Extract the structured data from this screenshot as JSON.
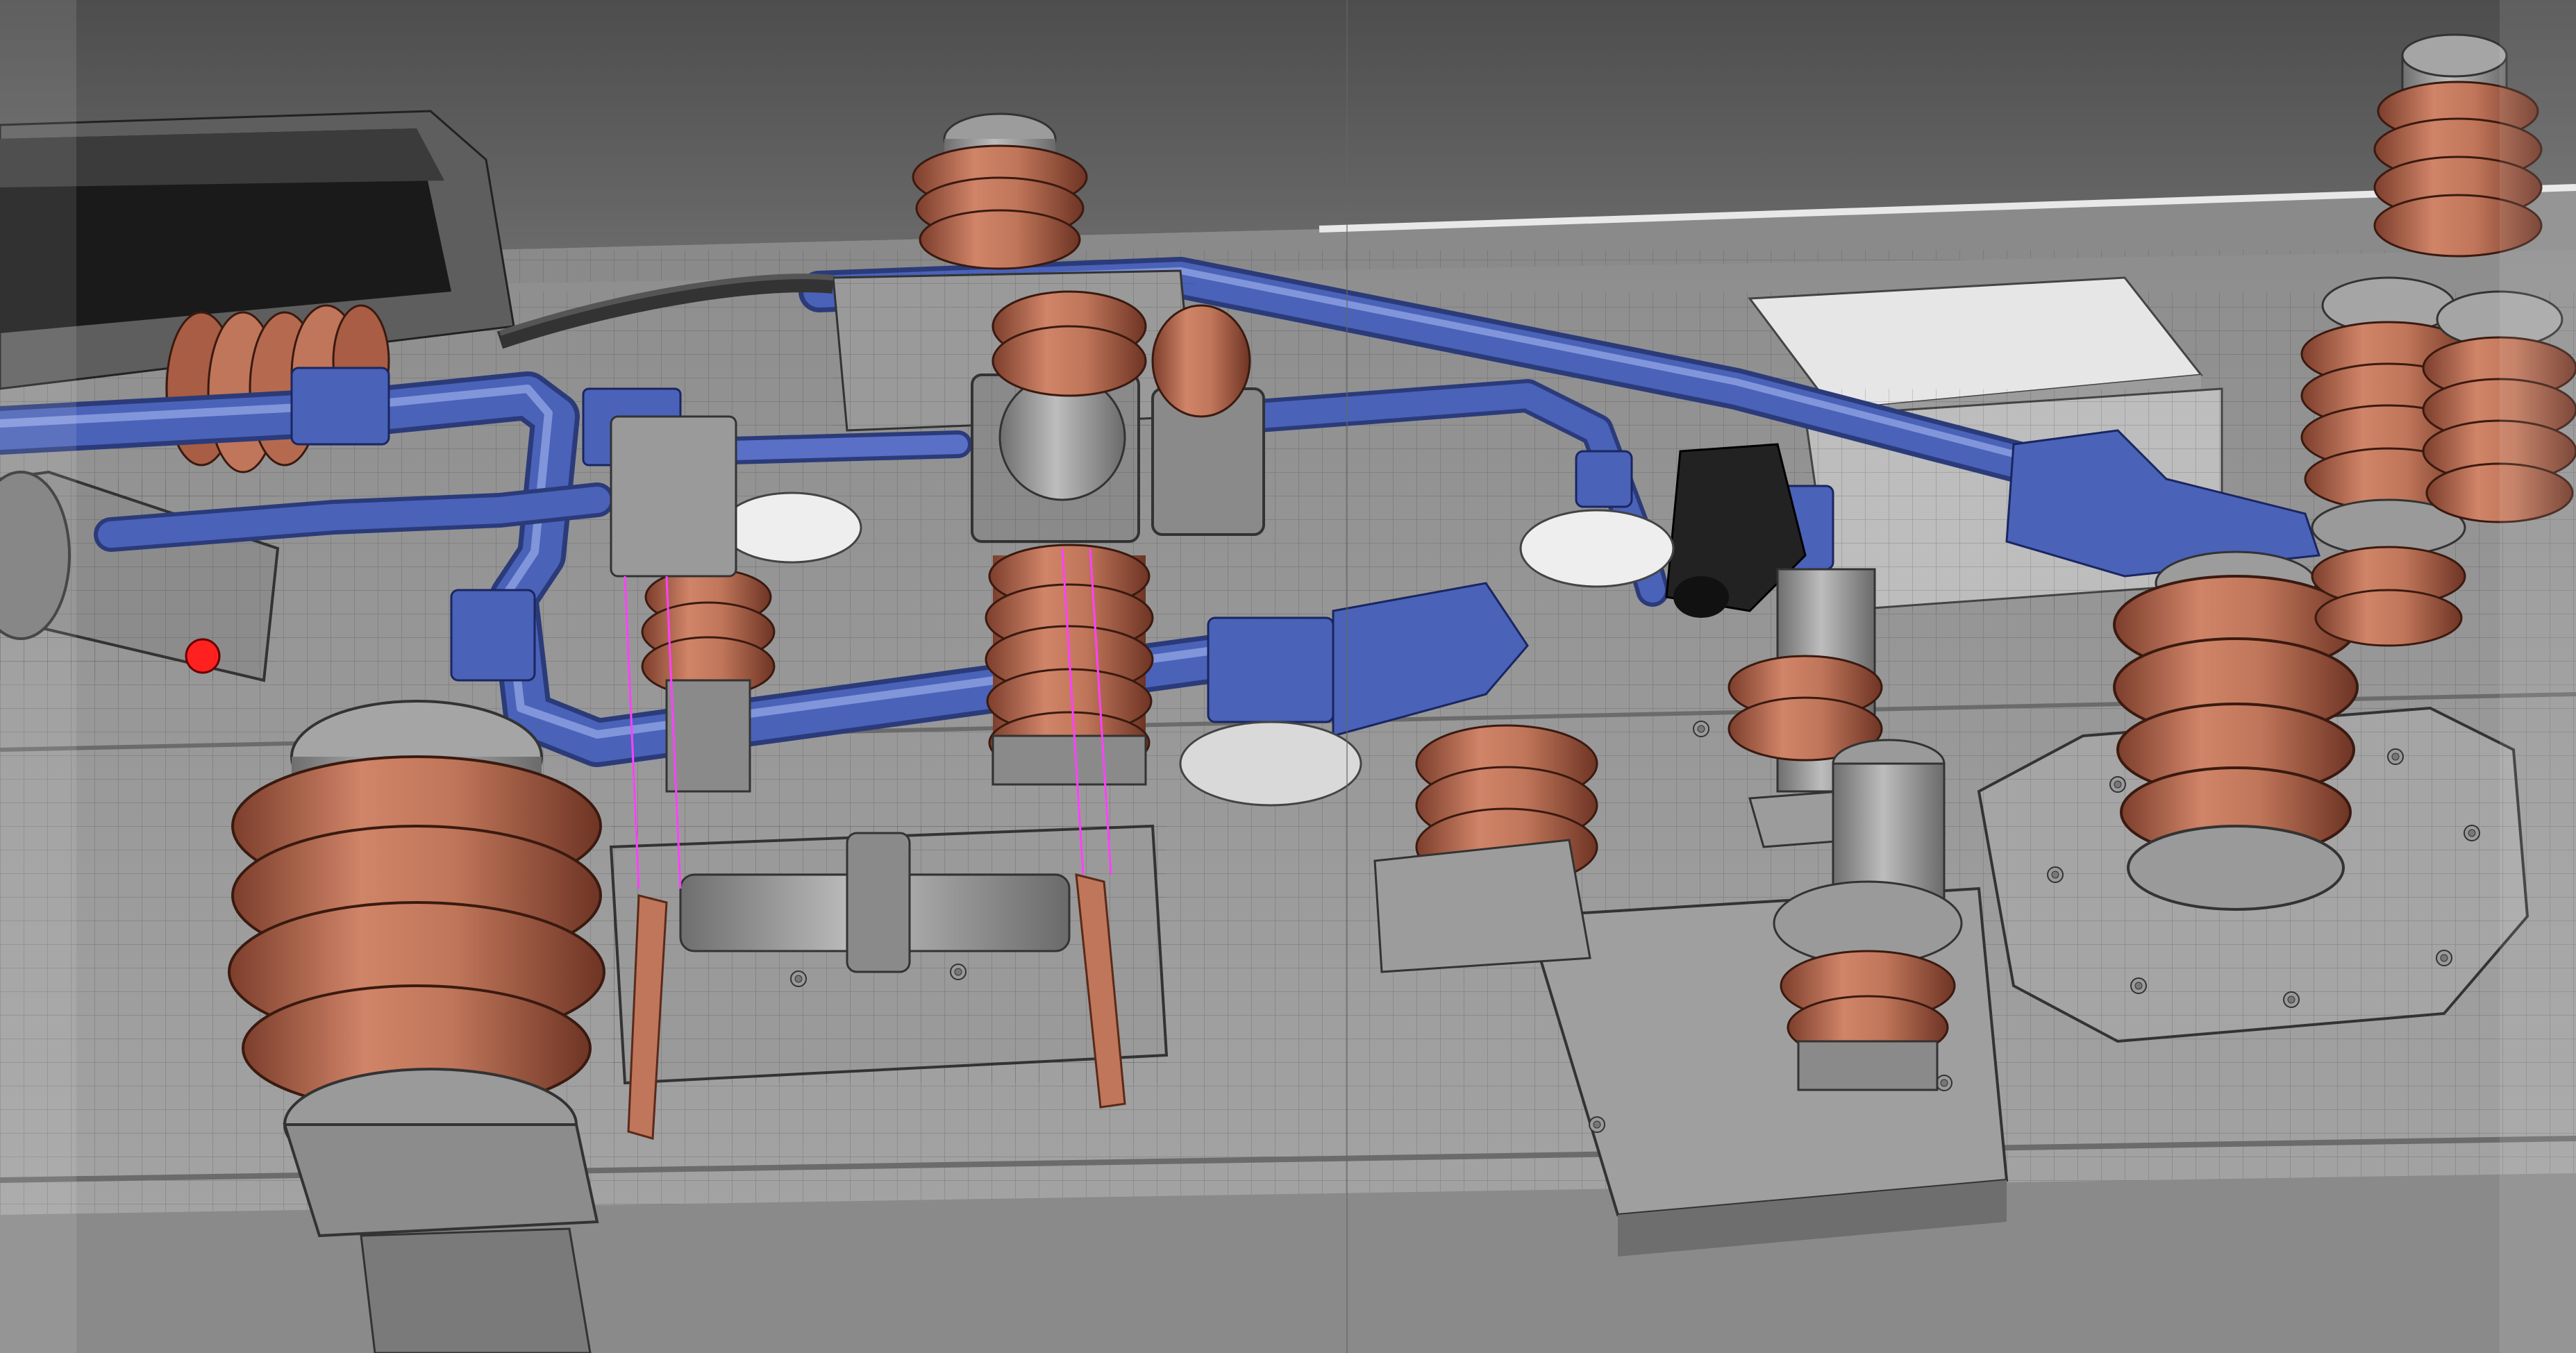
{
  "scene": {
    "colors": {
      "background": "#4a4a4a",
      "roof_far": "#5b5b5b",
      "roof_near": "#8f8f8f",
      "deck": "#9a9a9a",
      "deck_dark": "#7a7a7a",
      "metal": "#a8a8a8",
      "metal_dark": "#6e6e6e",
      "insulator": "#c0765a",
      "insulator_dark": "#8a4a36",
      "pipe": "#4a62b8",
      "pipe_light": "#6f86d6",
      "pipe_dark": "#2e3f80",
      "disc_white": "#eeeeee",
      "indicator_red": "#ff2020",
      "wire_magenta": "#ff40ff",
      "wireframe": "#222222"
    },
    "objects": [
      "roof-panel",
      "hatch-frame-left",
      "deck-plate-cover",
      "insulator-stack-front-left",
      "insulator-stack-center",
      "insulator-stack-back-center",
      "insulator-stack-right-tall",
      "insulator-stack-right-small",
      "insulator-stack-far-right",
      "blue-busbar-pipe",
      "disconnector-switch",
      "circuit-breaker-housing",
      "grey-bellows-left",
      "red-indicator-lamp"
    ]
  }
}
